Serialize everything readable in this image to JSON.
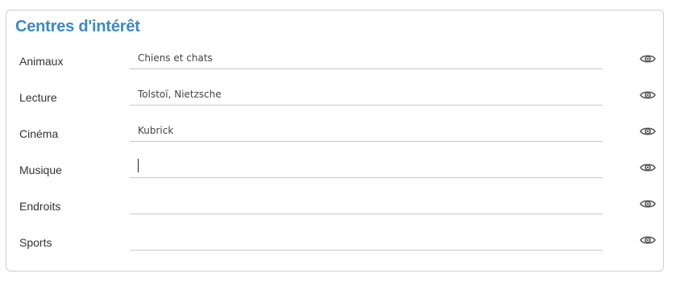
{
  "section": {
    "title": "Centres d'intérêt"
  },
  "fields": [
    {
      "label": "Animaux",
      "value": "Chiens et chats",
      "icon": "eye-icon"
    },
    {
      "label": "Lecture",
      "value": "Tolstoï, Nietzsche",
      "icon": "eye-icon"
    },
    {
      "label": "Cinéma",
      "value": "Kubrick",
      "icon": "eye-icon"
    },
    {
      "label": "Musique",
      "value": "",
      "focused": true,
      "icon": "eye-icon"
    },
    {
      "label": "Endroits",
      "value": "",
      "icon": "eye-icon"
    },
    {
      "label": "Sports",
      "value": "",
      "icon": "eye-icon"
    }
  ],
  "colors": {
    "title": "#3b8ac4",
    "label": "#333333",
    "border": "#cfcfcf",
    "underline": "#c9c9c9",
    "icon": "#555555"
  }
}
